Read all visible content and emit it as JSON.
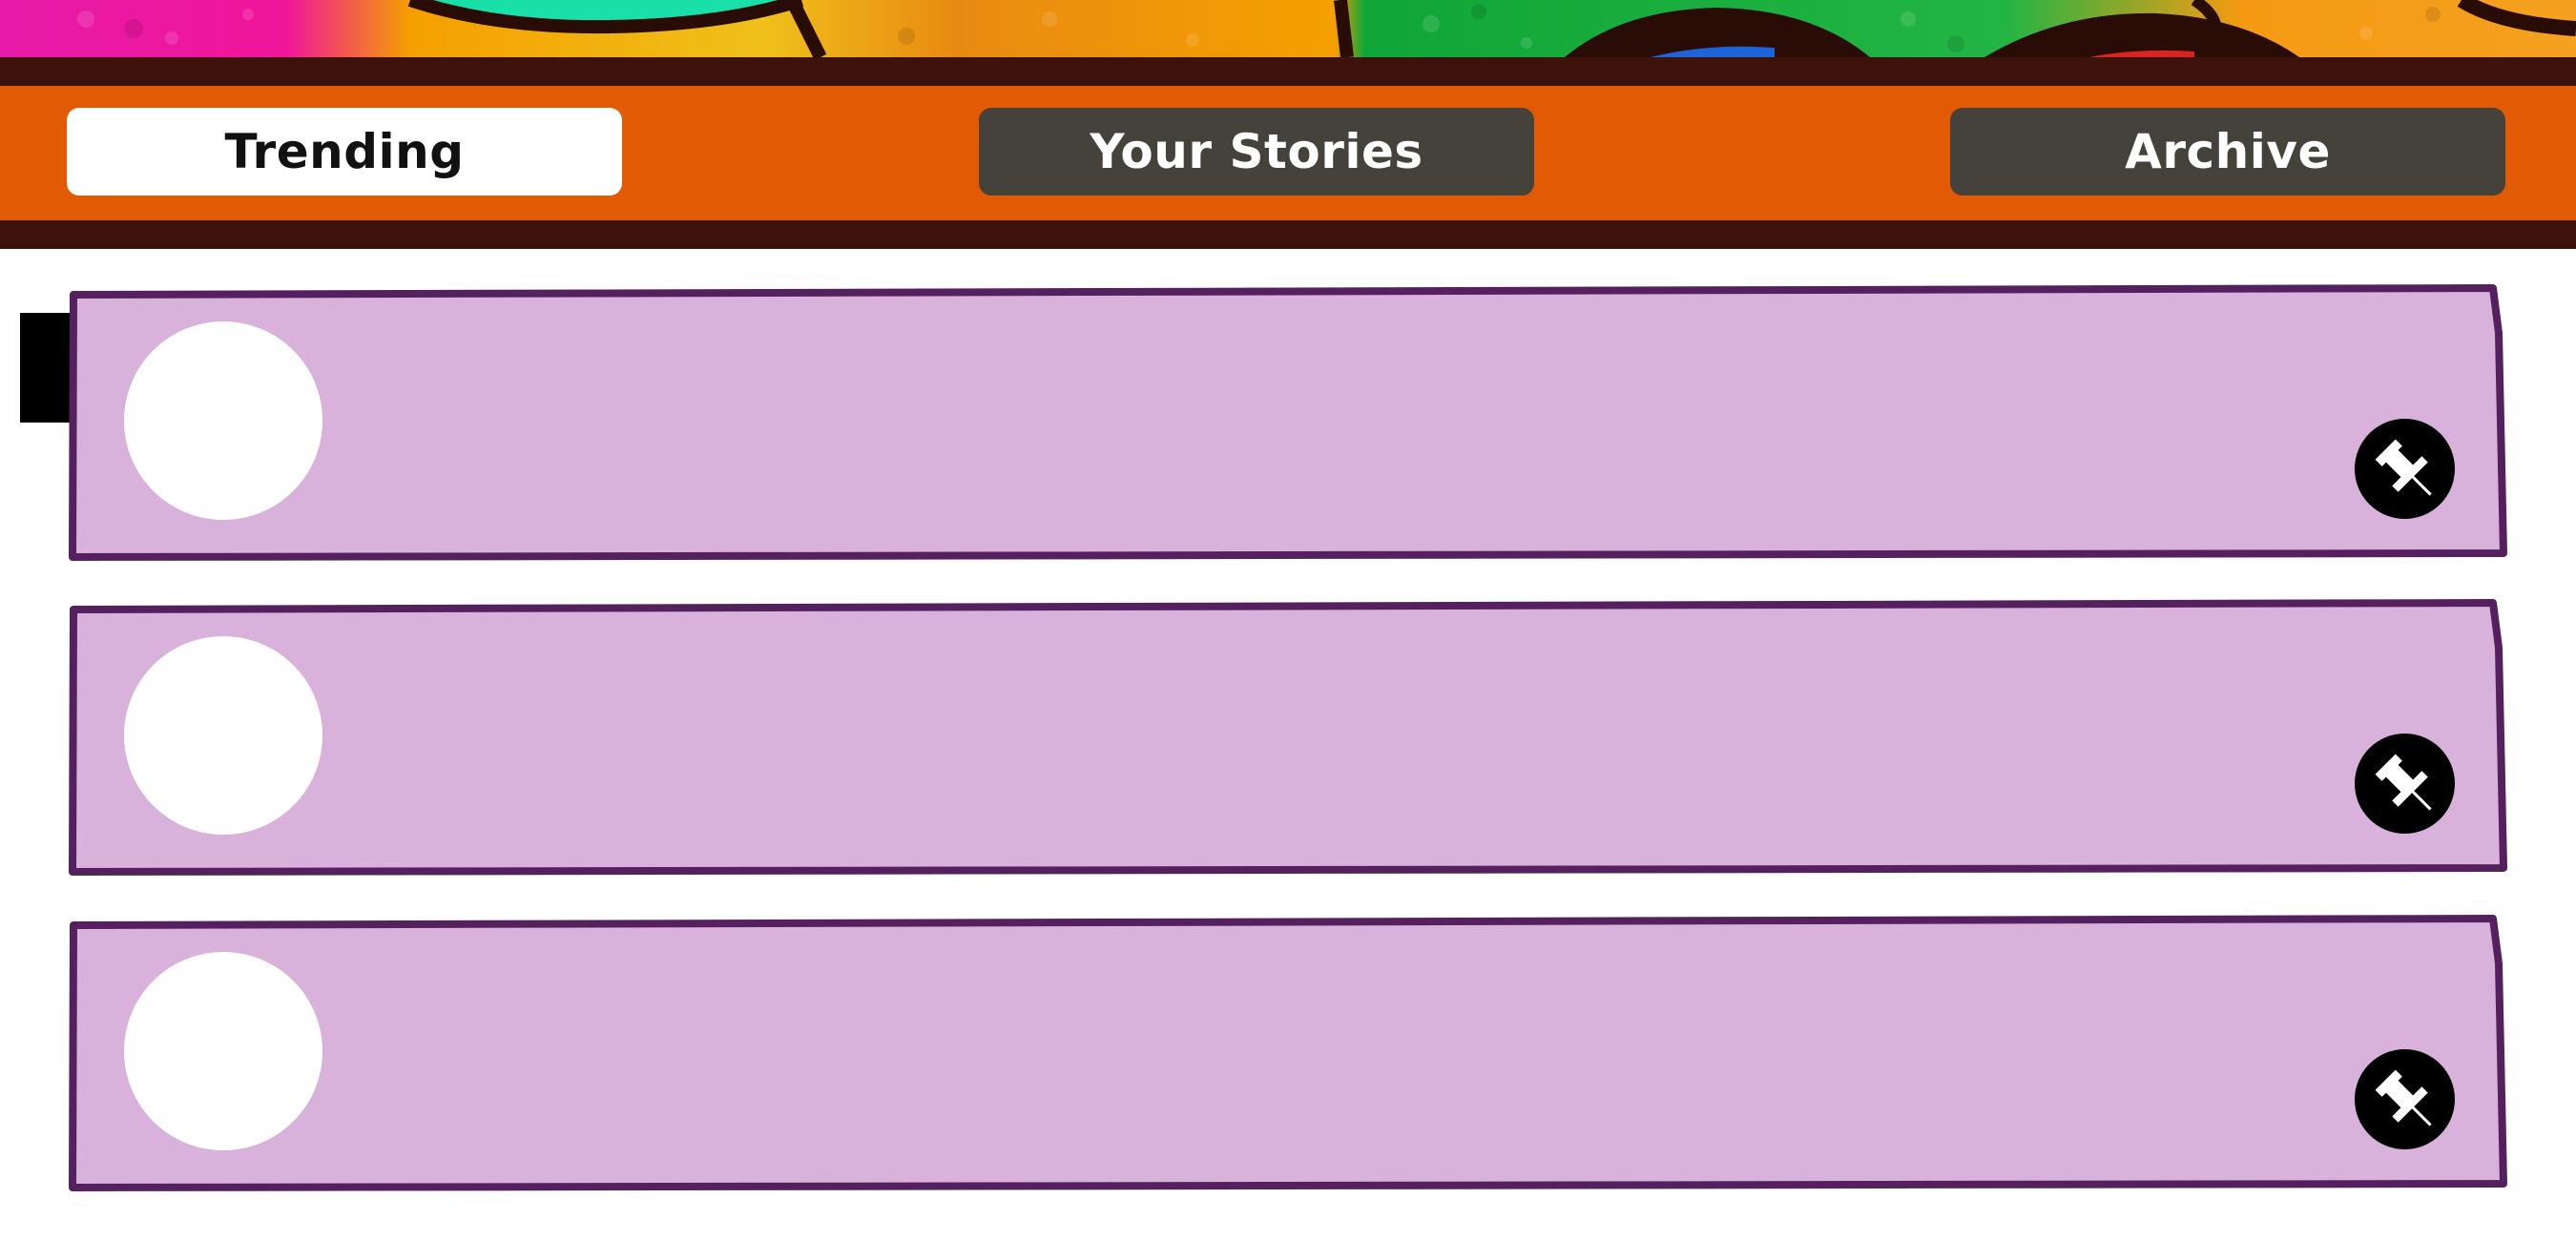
{
  "tabs": [
    {
      "label": "Trending",
      "active": true
    },
    {
      "label": "Your Stories",
      "active": false
    },
    {
      "label": "Archive",
      "active": false
    }
  ],
  "cards": [
    {
      "avatar": "avatar-placeholder",
      "action_icon": "pin-icon"
    },
    {
      "avatar": "avatar-placeholder",
      "action_icon": "pin-icon"
    },
    {
      "avatar": "avatar-placeholder",
      "action_icon": "pin-icon"
    }
  ],
  "colors": {
    "tabbar_border": "#3d120a",
    "tabbar_fill": "#e35a04",
    "tab_active_bg": "#ffffff",
    "tab_inactive_bg": "#44423b",
    "card_fill": "#d8b2da",
    "card_border": "#55205e",
    "pin_button_bg": "#000000"
  }
}
